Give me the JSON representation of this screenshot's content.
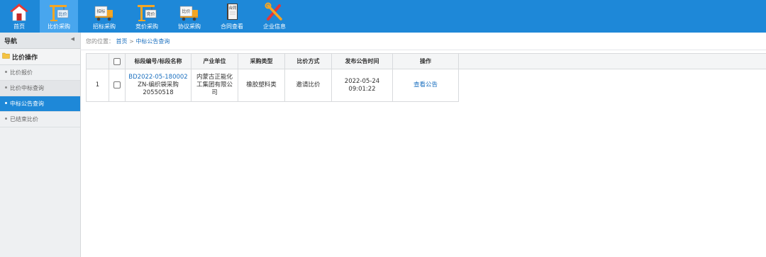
{
  "nav": {
    "items": [
      {
        "label": "首页",
        "icon": "home-icon",
        "active": false
      },
      {
        "label": "比价采购",
        "icon": "crane-compare-icon",
        "active": true,
        "tag": "比价"
      },
      {
        "label": "招标采购",
        "icon": "truck-tender-icon",
        "active": false,
        "tag": "招标"
      },
      {
        "label": "竞价采购",
        "icon": "crane-bid-icon",
        "active": false,
        "tag": "竞价"
      },
      {
        "label": "协议采购",
        "icon": "truck-compare-icon",
        "active": false,
        "tag": "比价"
      },
      {
        "label": "合同查看",
        "icon": "contract-book-icon",
        "active": false,
        "tag": "合同"
      },
      {
        "label": "企业信息",
        "icon": "tools-icon",
        "active": false
      }
    ]
  },
  "sidebar": {
    "header": "导航",
    "group_title": "比价操作",
    "items": [
      {
        "label": "比价报价",
        "state": "normal"
      },
      {
        "label": "比价中标查询",
        "state": "selected"
      },
      {
        "label": "中标公告查询",
        "state": "active"
      },
      {
        "label": "已结束比价",
        "state": "normal"
      }
    ]
  },
  "breadcrumb": {
    "prefix": "您的位置：",
    "home": "首页",
    "sep": ">",
    "current": "中标公告查询"
  },
  "table": {
    "headers": [
      "标段编号/标段名称",
      "产业单位",
      "采购类型",
      "比价方式",
      "发布公告时间",
      "操作"
    ],
    "rows": [
      {
        "index": "1",
        "code": "BD2022-05-180002",
        "name_line1": "ZN-编织袋采购",
        "name_line2": "20550518",
        "unit_line1": "内蒙古正能化",
        "unit_line2": "工集团有限公",
        "unit_line3": "司",
        "type": "橡胶塑料类",
        "method": "邀请比价",
        "time": "2022-05-24 09:01:22",
        "action": "查看公告"
      }
    ]
  },
  "colors": {
    "nav_bg": "#1e88d8",
    "nav_active": "#48a6ee",
    "link": "#1a6fbf"
  }
}
